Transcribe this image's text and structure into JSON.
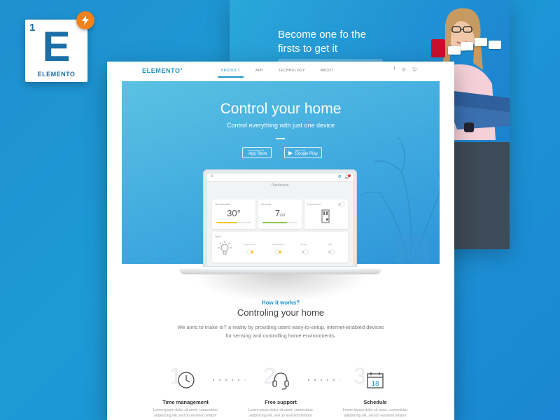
{
  "logo_badge": {
    "number": "1",
    "letter": "E",
    "name": "ELEMENTO"
  },
  "promo": {
    "headline": "Become one fo the firsts to get it"
  },
  "nav": {
    "brand": "ELEMENTO",
    "items": [
      {
        "label": "PRODUCT",
        "active": true
      },
      {
        "label": "APP"
      },
      {
        "label": "TECHNOLOGY"
      },
      {
        "label": "ABOUT"
      }
    ],
    "social": [
      "f",
      "instagram-icon",
      "twitter-icon"
    ]
  },
  "hero": {
    "title": "Control your home",
    "subtitle": "Control everything with just one device",
    "app_store": {
      "small": "Download on the",
      "big": "App Store"
    },
    "google_play": {
      "small": "GET IT ON",
      "big": "Google Play"
    }
  },
  "dashboard": {
    "title": "Dashboard",
    "temperature": {
      "label": "Temperature",
      "value": "30°",
      "level": 0.6
    },
    "security": {
      "label": "Security",
      "value": "7",
      "unit": "/10",
      "level": 0.7
    },
    "front_door": {
      "label": "Front Door"
    },
    "light": {
      "label": "Light",
      "rooms": [
        {
          "label": "Living Room",
          "on": true
        },
        {
          "label": "Dining Room",
          "on": true
        },
        {
          "label": "Kitchen",
          "on": false
        },
        {
          "label": "Hall",
          "on": false
        }
      ]
    },
    "accent": "#1b95c8",
    "temp_color": "#f5c518",
    "security_color": "#8bc34a"
  },
  "how": {
    "label": "How it works?",
    "title": "Controling your home",
    "description": "We aims to make IoT a reality by providing users easy-to-setup, internet-enabled devices for sensing and controlling home environments."
  },
  "features": [
    {
      "number": "1",
      "icon": "clock-icon",
      "name": "Time management",
      "desc": "Lorem ipsum dolor sit amet, consectetur adipisicing elit, sed do eiusmod tempor"
    },
    {
      "number": "2",
      "icon": "headset-icon",
      "name": "Free support",
      "desc": "Lorem ipsum dolor sit amet, consectetur adipisicing elit, sed do eiusmod tempor"
    },
    {
      "number": "3",
      "icon": "calendar-icon",
      "name": "Schedule",
      "desc": "Lorem ipsum dolor sit amet, consectetur adipisicing elit, sed do eiusmod tempor",
      "calendar_day": "18"
    }
  ]
}
